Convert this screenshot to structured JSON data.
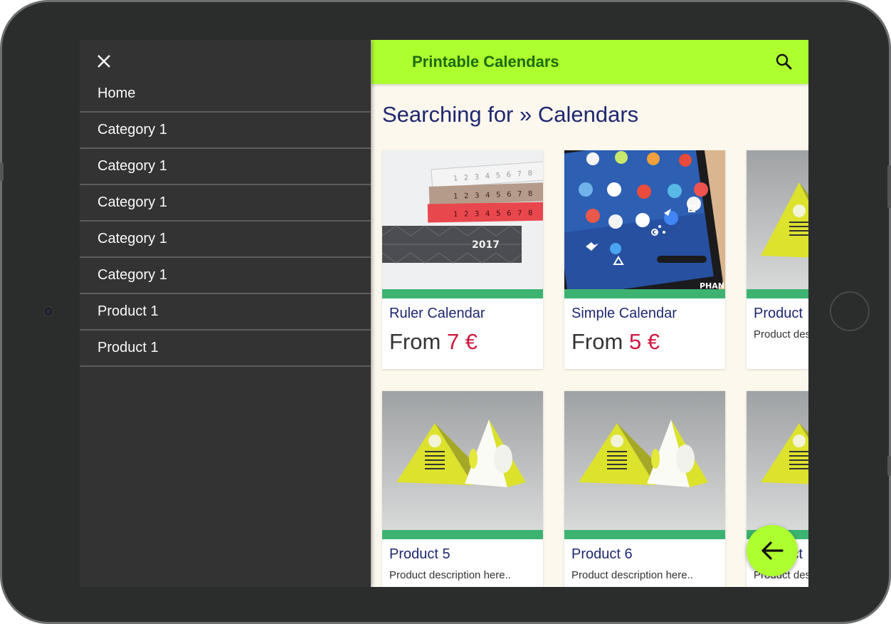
{
  "drawer": {
    "close_label": "✕",
    "items": [
      {
        "label": "Home"
      },
      {
        "label": "Category 1"
      },
      {
        "label": "Category 1"
      },
      {
        "label": "Category 1"
      },
      {
        "label": "Category 1"
      },
      {
        "label": "Category 1"
      },
      {
        "label": "Product 1"
      },
      {
        "label": "Product 1"
      }
    ]
  },
  "appbar": {
    "title": "Printable Calendars",
    "accent_color": "#adff2f",
    "search_icon": "search-icon"
  },
  "page": {
    "heading": "Searching for » Calendars"
  },
  "products": [
    {
      "name": "Ruler Calendar",
      "price_prefix": "From",
      "price_amount": "7 €",
      "image": "ruler-calendar-image"
    },
    {
      "name": "Simple Calendar",
      "price_prefix": "From",
      "price_amount": "5 €",
      "image": "phone-screen-image"
    },
    {
      "name": "Product",
      "description": "Product des",
      "image": "pyramid-calendar-image"
    },
    {
      "name": "Product 5",
      "description": "Product description here..",
      "image": "pyramid-calendar-image"
    },
    {
      "name": "Product 6",
      "description": "Product description here..",
      "image": "pyramid-calendar-image"
    },
    {
      "name": "Product",
      "description": "Product des",
      "image": "pyramid-calendar-image"
    }
  ],
  "fab": {
    "icon": "arrow-left-icon"
  },
  "colors": {
    "drawer_bg": "#333333",
    "card_bar": "#3cb371",
    "price": "#d0173f",
    "heading": "#1f2770"
  }
}
